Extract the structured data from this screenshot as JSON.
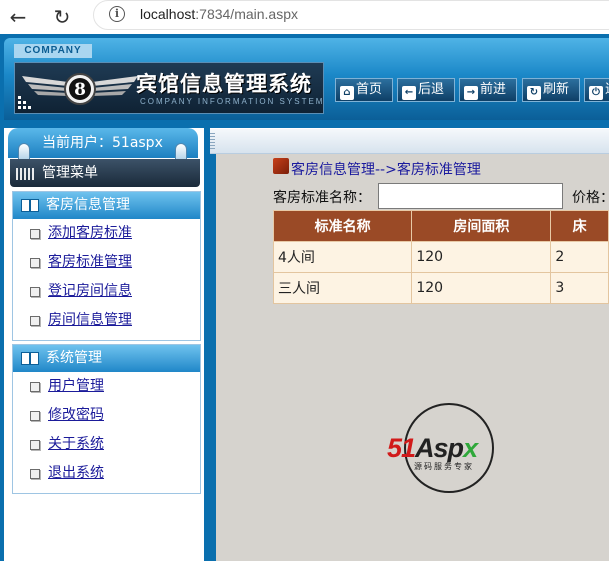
{
  "browser": {
    "url_host": "localhost",
    "url_rest": ":7834/main.aspx"
  },
  "app": {
    "company_tag": "COMPANY",
    "title": "宾馆信息管理系统",
    "subtitle": "COMPANY INFORMATION SYSTEM"
  },
  "topnav": {
    "home": "首页",
    "back": "后退",
    "forward": "前进",
    "refresh": "刷新",
    "exit": "退"
  },
  "sidebar": {
    "current_user": "当前用户：51aspx",
    "menu_title": "管理菜单",
    "groups": [
      {
        "title": "客房信息管理",
        "items": [
          "添加客房标准",
          "客房标准管理",
          "登记房间信息",
          "房间信息管理"
        ]
      },
      {
        "title": "系统管理",
        "items": [
          "用户管理",
          "修改密码",
          "关于系统",
          "退出系统"
        ]
      }
    ]
  },
  "main": {
    "breadcrumb": "客房信息管理-->客房标准管理",
    "search_label": "客房标准名称：",
    "search_value": "",
    "price_label": "价格：",
    "table": {
      "headers": [
        "标准名称",
        "房间面积",
        "床"
      ],
      "rows": [
        [
          "4人间",
          "120",
          "2"
        ],
        [
          "三人间",
          "120",
          "3"
        ]
      ]
    }
  },
  "watermark": {
    "brand_n": "51",
    "brand_a": "Asp",
    "brand_x": "x",
    "tagline": "源码服务专家"
  },
  "colors": {
    "frame_blue": "#0a6fae",
    "table_header": "#9a4a26",
    "table_row": "#fdf3e3",
    "content_bg": "#d6d3ce",
    "link": "#1b1b9a"
  }
}
